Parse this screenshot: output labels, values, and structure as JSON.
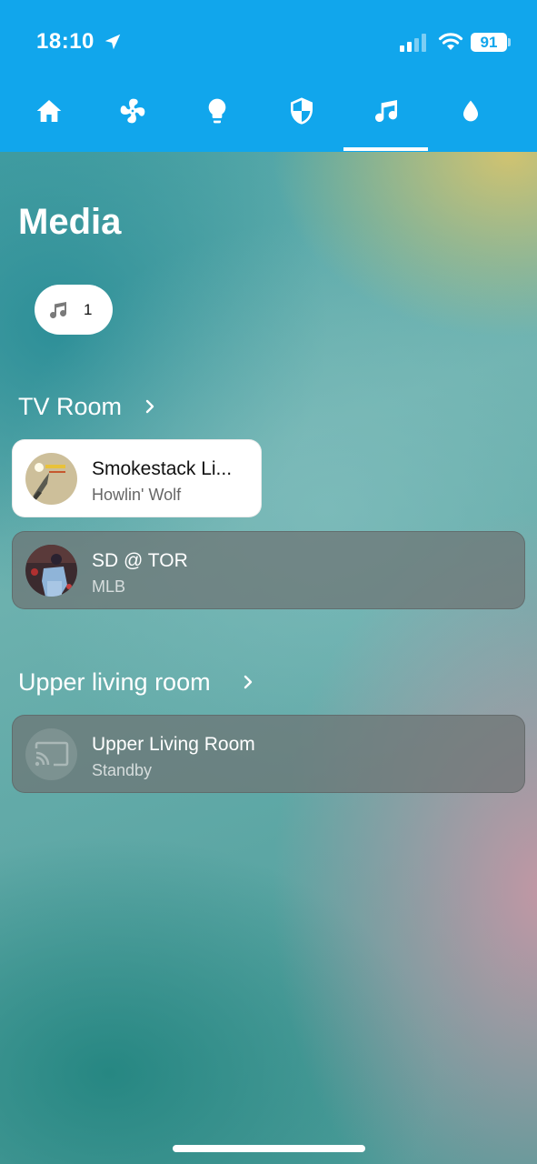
{
  "status": {
    "time": "18:10",
    "battery": "91"
  },
  "tabs": [
    {
      "icon": "home-icon",
      "active": false
    },
    {
      "icon": "fan-icon",
      "active": false
    },
    {
      "icon": "lightbulb-icon",
      "active": false
    },
    {
      "icon": "shield-icon",
      "active": false
    },
    {
      "icon": "music-note-icon",
      "active": true
    },
    {
      "icon": "water-drop-icon",
      "active": false
    }
  ],
  "page": {
    "title": "Media"
  },
  "filter_chip": {
    "icon": "music-note-icon",
    "count": "1"
  },
  "sections": [
    {
      "title": "TV Room",
      "players": [
        {
          "title": "Smokestack Li...",
          "subtitle": "Howlin' Wolf",
          "state": "playing"
        },
        {
          "title": "SD @ TOR",
          "subtitle": "MLB",
          "state": "idle"
        }
      ]
    },
    {
      "title": "Upper living room",
      "players": [
        {
          "title": "Upper Living Room",
          "subtitle": "Standby",
          "state": "standby",
          "icon": "cast-icon"
        }
      ]
    }
  ],
  "colors": {
    "topbar": "#11a6ec",
    "active_card": "#ffffff",
    "inactive_card": "#6e7373"
  }
}
